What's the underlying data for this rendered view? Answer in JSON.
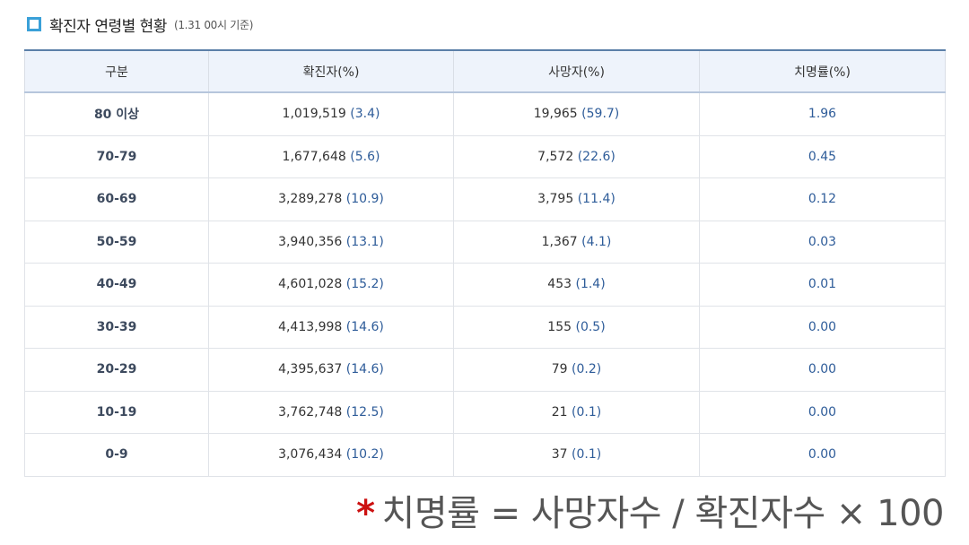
{
  "header": {
    "title": "확진자 연령별 현황",
    "subtitle": "(1.31 00시 기준)"
  },
  "table": {
    "headers": [
      "구분",
      "확진자(%)",
      "사망자(%)",
      "치명률(%)"
    ],
    "rows": [
      {
        "age": "80 이상",
        "cases": "1,019,519",
        "cases_pct": "(3.4)",
        "deaths": "19,965",
        "deaths_pct": "(59.7)",
        "cfr": "1.96"
      },
      {
        "age": "70-79",
        "cases": "1,677,648",
        "cases_pct": "(5.6)",
        "deaths": "7,572",
        "deaths_pct": "(22.6)",
        "cfr": "0.45"
      },
      {
        "age": "60-69",
        "cases": "3,289,278",
        "cases_pct": "(10.9)",
        "deaths": "3,795",
        "deaths_pct": "(11.4)",
        "cfr": "0.12"
      },
      {
        "age": "50-59",
        "cases": "3,940,356",
        "cases_pct": "(13.1)",
        "deaths": "1,367",
        "deaths_pct": "(4.1)",
        "cfr": "0.03"
      },
      {
        "age": "40-49",
        "cases": "4,601,028",
        "cases_pct": "(15.2)",
        "deaths": "453",
        "deaths_pct": "(1.4)",
        "cfr": "0.01"
      },
      {
        "age": "30-39",
        "cases": "4,413,998",
        "cases_pct": "(14.6)",
        "deaths": "155",
        "deaths_pct": "(0.5)",
        "cfr": "0.00"
      },
      {
        "age": "20-29",
        "cases": "4,395,637",
        "cases_pct": "(14.6)",
        "deaths": "79",
        "deaths_pct": "(0.2)",
        "cfr": "0.00"
      },
      {
        "age": "10-19",
        "cases": "3,762,748",
        "cases_pct": "(12.5)",
        "deaths": "21",
        "deaths_pct": "(0.1)",
        "cfr": "0.00"
      },
      {
        "age": "0-9",
        "cases": "3,076,434",
        "cases_pct": "(10.2)",
        "deaths": "37",
        "deaths_pct": "(0.1)",
        "cfr": "0.00"
      }
    ]
  },
  "footnote": {
    "star": "*",
    "text": "치명률 = 사망자수 / 확진자수 × 100"
  },
  "colors": {
    "accent": "#3aa0d8",
    "header_bg": "#eef3fb",
    "value_blue": "#2e5c99",
    "star_red": "#cc1111"
  },
  "icons": {
    "title_marker": "square-bullet-icon"
  }
}
